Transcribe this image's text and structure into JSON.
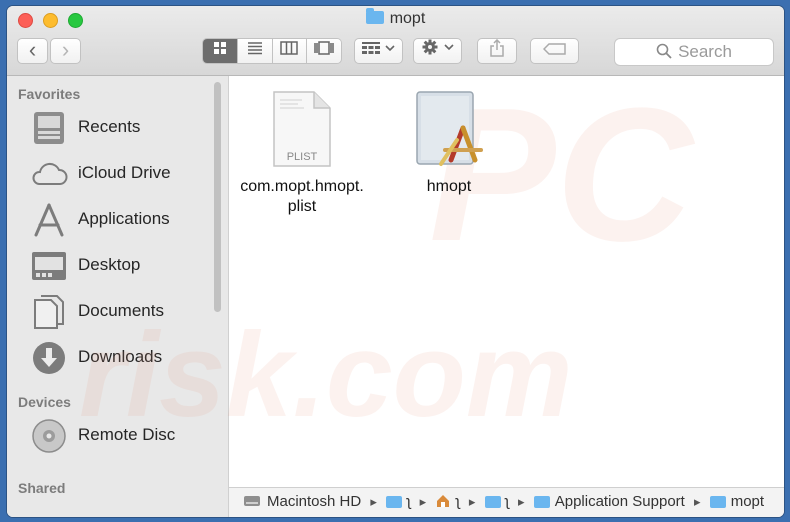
{
  "window": {
    "title": "mopt"
  },
  "toolbar": {
    "back_glyph": "‹",
    "forward_glyph": "›",
    "views": [
      "icon-view",
      "list-view",
      "column-view",
      "gallery-view"
    ],
    "search_placeholder": "Search"
  },
  "sidebar": {
    "favorites_label": "Favorites",
    "favorites": [
      {
        "label": "Recents",
        "icon": "recents-icon"
      },
      {
        "label": "iCloud Drive",
        "icon": "cloud-icon"
      },
      {
        "label": "Applications",
        "icon": "applications-icon"
      },
      {
        "label": "Desktop",
        "icon": "desktop-icon"
      },
      {
        "label": "Documents",
        "icon": "documents-icon"
      },
      {
        "label": "Downloads",
        "icon": "downloads-icon"
      }
    ],
    "devices_label": "Devices",
    "devices": [
      {
        "label": "Remote Disc",
        "icon": "disc-icon"
      }
    ],
    "shared_label": "Shared"
  },
  "files": [
    {
      "name": "com.mopt.hmopt.\nplist",
      "badge": "PLIST",
      "icon": "plist-file-icon"
    },
    {
      "name": "hmopt",
      "icon": "app-executable-icon"
    }
  ],
  "path": {
    "disk": "Macintosh HD",
    "c1": "ʅ",
    "c2": "ʅ",
    "c3": "ʅ",
    "app_support": "Application Support",
    "current": "mopt"
  },
  "watermark": {
    "line1": "PC",
    "line2": "risk.com"
  }
}
